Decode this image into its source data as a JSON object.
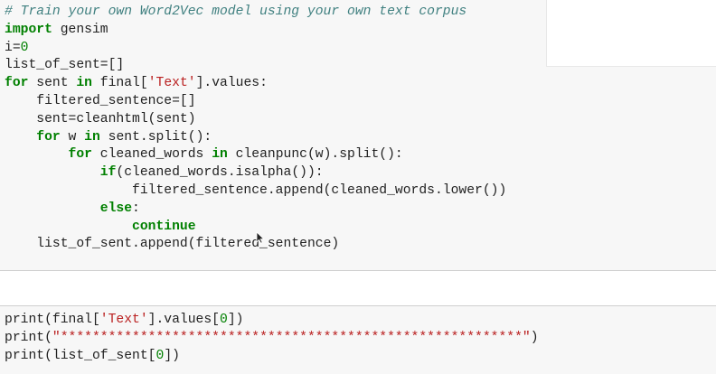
{
  "cell1": {
    "lines": [
      {
        "indent": "",
        "parts": [
          {
            "t": "# Train your own Word2Vec model using your own text corpus",
            "c": "cm"
          }
        ]
      },
      {
        "indent": "",
        "parts": [
          {
            "t": "import",
            "c": "kw"
          },
          {
            "t": " gensim",
            "c": "plain"
          }
        ]
      },
      {
        "indent": "",
        "parts": [
          {
            "t": "i=",
            "c": "plain"
          },
          {
            "t": "0",
            "c": "num"
          }
        ]
      },
      {
        "indent": "",
        "parts": [
          {
            "t": "list_of_sent=[]",
            "c": "plain"
          }
        ]
      },
      {
        "indent": "",
        "parts": [
          {
            "t": "for",
            "c": "kw"
          },
          {
            "t": " sent ",
            "c": "plain"
          },
          {
            "t": "in",
            "c": "kw"
          },
          {
            "t": " final[",
            "c": "plain"
          },
          {
            "t": "'Text'",
            "c": "str"
          },
          {
            "t": "].values:",
            "c": "plain"
          }
        ]
      },
      {
        "indent": "    ",
        "parts": [
          {
            "t": "filtered_sentence=[]",
            "c": "plain"
          }
        ]
      },
      {
        "indent": "    ",
        "parts": [
          {
            "t": "sent=cleanhtml(sent)",
            "c": "plain"
          }
        ]
      },
      {
        "indent": "    ",
        "parts": [
          {
            "t": "for",
            "c": "kw"
          },
          {
            "t": " w ",
            "c": "plain"
          },
          {
            "t": "in",
            "c": "kw"
          },
          {
            "t": " sent.split():",
            "c": "plain"
          }
        ]
      },
      {
        "indent": "        ",
        "parts": [
          {
            "t": "for",
            "c": "kw"
          },
          {
            "t": " cleaned_words ",
            "c": "plain"
          },
          {
            "t": "in",
            "c": "kw"
          },
          {
            "t": " cleanpunc(w).split():",
            "c": "plain"
          }
        ]
      },
      {
        "indent": "            ",
        "parts": [
          {
            "t": "if",
            "c": "kw"
          },
          {
            "t": "(cleaned_words.isalpha()):",
            "c": "plain"
          }
        ]
      },
      {
        "indent": "                ",
        "parts": [
          {
            "t": "filtered_sentence.append(cleaned_words.lower())",
            "c": "plain"
          }
        ]
      },
      {
        "indent": "            ",
        "parts": [
          {
            "t": "else",
            "c": "kw"
          },
          {
            "t": ":",
            "c": "plain"
          }
        ]
      },
      {
        "indent": "                ",
        "parts": [
          {
            "t": "continue",
            "c": "kw"
          }
        ]
      },
      {
        "indent": "    ",
        "parts": [
          {
            "t": "list_of_sent.append(filtered_sentence)",
            "c": "plain"
          }
        ]
      }
    ]
  },
  "cell2": {
    "lines": [
      {
        "indent": "",
        "parts": [
          {
            "t": "print",
            "c": "plain"
          },
          {
            "t": "(final[",
            "c": "plain"
          },
          {
            "t": "'Text'",
            "c": "str"
          },
          {
            "t": "].values[",
            "c": "plain"
          },
          {
            "t": "0",
            "c": "num"
          },
          {
            "t": "])",
            "c": "plain"
          }
        ]
      },
      {
        "indent": "",
        "parts": [
          {
            "t": "print",
            "c": "plain"
          },
          {
            "t": "(",
            "c": "plain"
          },
          {
            "t": "\"**********************************************************\"",
            "c": "str"
          },
          {
            "t": ")",
            "c": "plain"
          }
        ]
      },
      {
        "indent": "",
        "parts": [
          {
            "t": "print",
            "c": "plain"
          },
          {
            "t": "(list_of_sent[",
            "c": "plain"
          },
          {
            "t": "0",
            "c": "num"
          },
          {
            "t": "])",
            "c": "plain"
          }
        ]
      }
    ]
  },
  "icons": {
    "cursor": "mouse-pointer-icon"
  }
}
